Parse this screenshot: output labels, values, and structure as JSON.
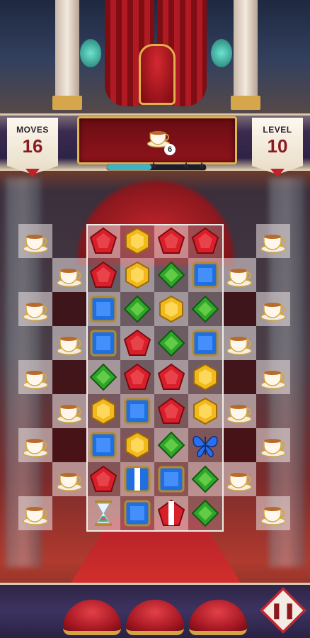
{
  "hud": {
    "moves_label": "MOVES",
    "moves_value": "16",
    "level_label": "LEVEL",
    "level_value": "10",
    "goal": {
      "item": "teacup",
      "count": "6"
    },
    "progress": 0.45,
    "stars": [
      "star",
      "star",
      "star"
    ]
  },
  "colors": {
    "red": "#d81f2a",
    "yellow": "#f2b81c",
    "green": "#2fa52a",
    "blue": "#1f6fe0",
    "panel": "#8f141b",
    "gold": "#e0b44e"
  },
  "board": {
    "cols": 8,
    "rows": 9,
    "legend": "R=red pentagon, Y=yellow hexagon, G=green diamond, B=blue square, C=teacup, X=void, F=blue butterfly, H=hourglass, V=vertical-striped blue, P=striped red pentagon, E=empty",
    "grid": [
      [
        "C",
        "E",
        "R",
        "Y",
        "R",
        "R",
        "E",
        "C"
      ],
      [
        "E",
        "C",
        "R",
        "Y",
        "G",
        "B",
        "C",
        "E"
      ],
      [
        "C",
        "X",
        "B",
        "G",
        "Y",
        "G",
        "X",
        "C"
      ],
      [
        "E",
        "C",
        "B",
        "R",
        "G",
        "B",
        "C",
        "E"
      ],
      [
        "C",
        "X",
        "G",
        "R",
        "R",
        "Y",
        "X",
        "C"
      ],
      [
        "E",
        "C",
        "Y",
        "B",
        "R",
        "Y",
        "C",
        "E"
      ],
      [
        "C",
        "X",
        "B",
        "Y",
        "G",
        "F",
        "X",
        "C"
      ],
      [
        "E",
        "C",
        "R",
        "V",
        "B",
        "G",
        "C",
        "E"
      ],
      [
        "C",
        "E",
        "H",
        "B",
        "P",
        "G",
        "E",
        "C"
      ]
    ]
  },
  "boosters": [
    "cushion",
    "cushion",
    "cushion"
  ],
  "pause_icon": "pause-icon"
}
